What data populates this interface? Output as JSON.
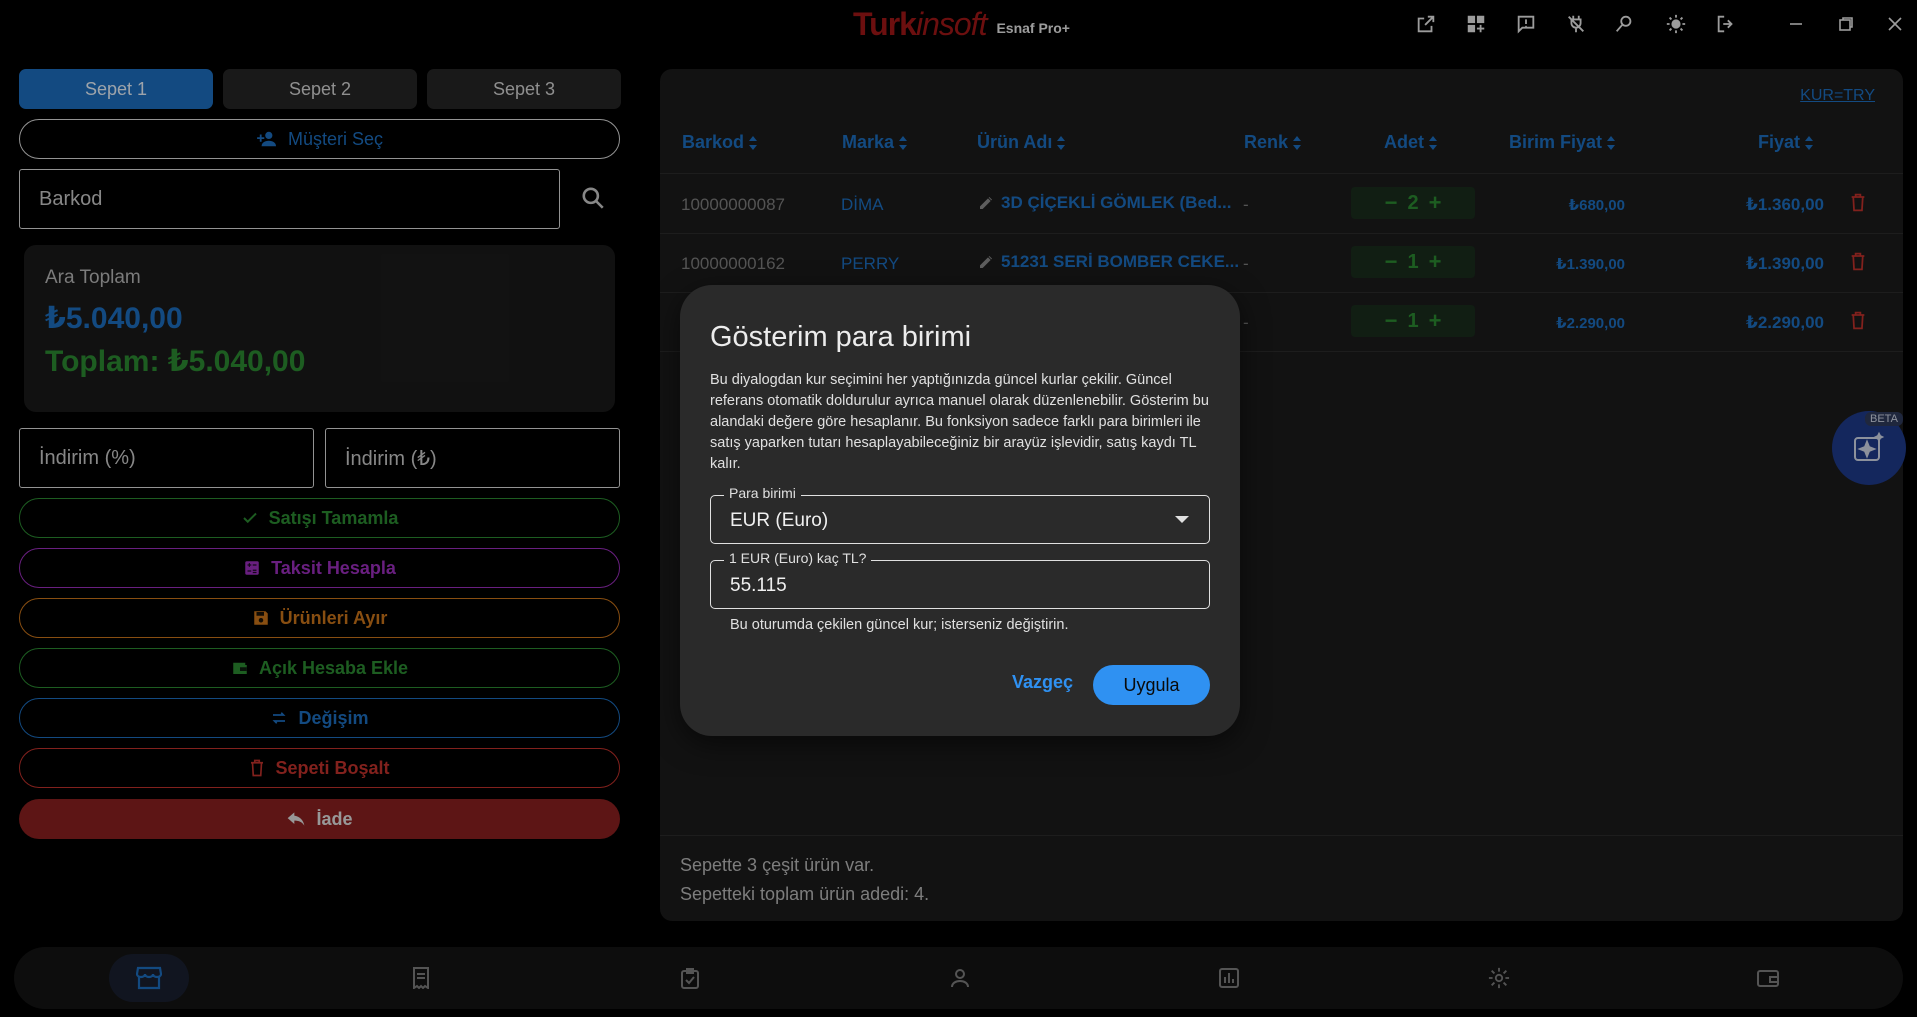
{
  "app": {
    "brand_main": "Turk",
    "brand_accent": "insoft",
    "brand_edition": "Esnaf Pro+"
  },
  "titlebar_icons": [
    "open-external-icon",
    "dashboard-add-icon",
    "feedback-icon",
    "unplug-icon",
    "search-user-icon",
    "brightness-icon",
    "logout-icon",
    "minimize-icon",
    "maximize-icon",
    "close-icon"
  ],
  "tabs": [
    {
      "label": "Sepet 1",
      "active": true
    },
    {
      "label": "Sepet 2",
      "active": false
    },
    {
      "label": "Sepet 3",
      "active": false
    }
  ],
  "customer": {
    "label": "Müşteri Seç"
  },
  "barcode": {
    "placeholder": "Barkod"
  },
  "totals": {
    "subtotal_label": "Ara Toplam",
    "subtotal": "₺5.040,00",
    "total": "Toplam: ₺5.040,00"
  },
  "discount": {
    "percent_placeholder": "İndirim (%)",
    "amount_placeholder": "İndirim (₺)"
  },
  "actions": {
    "complete": "Satışı Tamamla",
    "installment": "Taksit Hesapla",
    "reserve": "Ürünleri Ayır",
    "open_account": "Açık Hesaba Ekle",
    "exchange": "Değişim",
    "empty_cart": "Sepeti Boşalt",
    "return": "İade"
  },
  "colors": {
    "primary": "#1c6ebf",
    "success": "#2b8a32",
    "installment": "#9b2fbd",
    "reserve": "#c9731a",
    "danger": "#c0312b",
    "dialog_accent": "#2f91f2"
  },
  "cart": {
    "currency_link": "KUR=TRY",
    "columns": [
      "Barkod",
      "Marka",
      "Ürün Adı",
      "Renk",
      "Adet",
      "Birim Fiyat",
      "Fiyat"
    ],
    "rows": [
      {
        "barkod": "10000000087",
        "marka": "DİMA",
        "urun": "3D ÇİÇEKLİ GÖMLEK (Bed...",
        "renk": "-",
        "adet": "2",
        "birim": "₺680,00",
        "fiyat": "₺1.360,00"
      },
      {
        "barkod": "10000000162",
        "marka": "PERRY",
        "urun": "51231 SERİ BOMBER CEKE...",
        "renk": "-",
        "adet": "1",
        "birim": "₺1.390,00",
        "fiyat": "₺1.390,00"
      },
      {
        "barkod": "",
        "marka": "",
        "urun": "",
        "renk": "-",
        "adet": "1",
        "birim": "₺2.290,00",
        "fiyat": "₺2.290,00"
      }
    ],
    "footer_variety": "Sepette 3 çeşit ürün var.",
    "footer_count": "Sepetteki toplam ürün adedi: 4."
  },
  "dialog": {
    "title": "Gösterim para birimi",
    "description": "Bu diyalogdan kur seçimini her yaptığınızda güncel kurlar çekilir. Güncel referans otomatik doldurulur ayrıca manuel olarak düzenlenebilir. Gösterim bu alandaki değere göre hesaplanır. Bu fonksiyon sadece farklı para birimleri ile satış yaparken tutarı hesaplayabileceğiniz bir arayüz işlevidir, satış kaydı TL kalır.",
    "currency_label": "Para birimi",
    "currency_value": "EUR (Euro)",
    "rate_label": "1 EUR (Euro) kaç TL?",
    "rate_value": "55.115",
    "helper": "Bu oturumda çekilen güncel kur; isterseniz değiştirin.",
    "cancel": "Vazgeç",
    "apply": "Uygula"
  },
  "fab": {
    "badge": "BETA"
  },
  "bottom_nav": [
    "store-icon",
    "receipt-icon",
    "clipboard-check-icon",
    "user-icon",
    "chart-icon",
    "settings-icon",
    "wallet-icon"
  ]
}
